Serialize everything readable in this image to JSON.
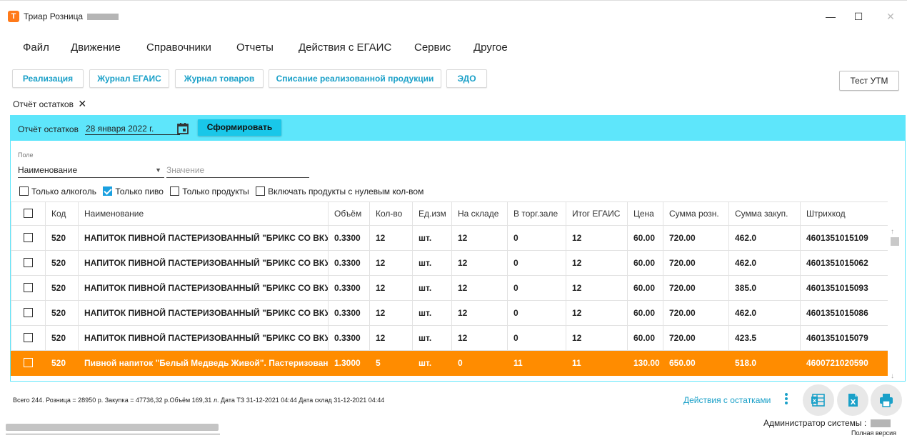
{
  "window": {
    "title": "Триар Розница",
    "logo_letter": "T",
    "minimize": "—",
    "maximize": "☐",
    "close": "✕"
  },
  "menu": [
    "Файл",
    "Движение",
    "Справочники",
    "Отчеты",
    "Действия с ЕГАИС",
    "Сервис",
    "Другое"
  ],
  "quick_buttons": [
    "Реализация",
    "Журнал ЕГАИС",
    "Журнал товаров",
    "Списание реализованной продукции",
    "ЭДО"
  ],
  "test_utm": "Тест УТМ",
  "doc_tab": {
    "label": "Отчёт остатков",
    "close": "✕"
  },
  "report_bar": {
    "label": "Отчёт остатков",
    "date": "28 января 2022 г.",
    "form_button": "Сформировать"
  },
  "filter": {
    "field_label": "Поле",
    "field_value": "Наименование",
    "value_placeholder": "Значение",
    "checkboxes": [
      {
        "label": "Только алкоголь",
        "checked": false
      },
      {
        "label": "Только пиво",
        "checked": true
      },
      {
        "label": "Только продукты",
        "checked": false
      },
      {
        "label": "Включать продукты с нулевым кол-вом",
        "checked": false
      }
    ]
  },
  "table": {
    "columns": [
      "",
      "Код",
      "Наименование",
      "Объём",
      "Кол-во",
      "Ед.изм",
      "На складе",
      "В торг.зале",
      "Итог ЕГАИС",
      "Цена",
      "Сумма розн.",
      "Сумма закуп.",
      "Штрихкод"
    ],
    "rows": [
      {
        "code": "520",
        "name": "НАПИТОК ПИВНОЙ ПАСТЕРИЗОВАННЫЙ \"БРИКС СО ВКУСОМ",
        "volume": "0.3300",
        "qty": "12",
        "unit": "шт.",
        "stock": "12",
        "hall": "0",
        "egais": "12",
        "price": "60.00",
        "retail": "720.00",
        "purchase": "462.0",
        "barcode": "4601351015109",
        "selected": false
      },
      {
        "code": "520",
        "name": "НАПИТОК ПИВНОЙ ПАСТЕРИЗОВАННЫЙ \"БРИКС СО ВКУСОМ",
        "volume": "0.3300",
        "qty": "12",
        "unit": "шт.",
        "stock": "12",
        "hall": "0",
        "egais": "12",
        "price": "60.00",
        "retail": "720.00",
        "purchase": "462.0",
        "barcode": "4601351015062",
        "selected": false
      },
      {
        "code": "520",
        "name": "НАПИТОК ПИВНОЙ ПАСТЕРИЗОВАННЫЙ \"БРИКС СО ВКУСОМ",
        "volume": "0.3300",
        "qty": "12",
        "unit": "шт.",
        "stock": "12",
        "hall": "0",
        "egais": "12",
        "price": "60.00",
        "retail": "720.00",
        "purchase": "385.0",
        "barcode": "4601351015093",
        "selected": false
      },
      {
        "code": "520",
        "name": "НАПИТОК ПИВНОЙ ПАСТЕРИЗОВАННЫЙ \"БРИКС СО ВКУСОМ",
        "volume": "0.3300",
        "qty": "12",
        "unit": "шт.",
        "stock": "12",
        "hall": "0",
        "egais": "12",
        "price": "60.00",
        "retail": "720.00",
        "purchase": "462.0",
        "barcode": "4601351015086",
        "selected": false
      },
      {
        "code": "520",
        "name": "НАПИТОК ПИВНОЙ ПАСТЕРИЗОВАННЫЙ \"БРИКС СО ВКУСОМ",
        "volume": "0.3300",
        "qty": "12",
        "unit": "шт.",
        "stock": "12",
        "hall": "0",
        "egais": "12",
        "price": "60.00",
        "retail": "720.00",
        "purchase": "423.5",
        "barcode": "4601351015079",
        "selected": false
      },
      {
        "code": "520",
        "name": "Пивной напиток \"Белый Медведь Живой\". Пастеризованный",
        "volume": "1.3000",
        "qty": "5",
        "unit": "шт.",
        "stock": "0",
        "hall": "11",
        "egais": "11",
        "price": "130.00",
        "retail": "650.00",
        "purchase": "518.0",
        "barcode": "4600721020590",
        "selected": true
      }
    ]
  },
  "footer": {
    "summary": "Всего 244. Розница = 28950 р. Закупка = 47736,32 р.Объём 169,31 л. Дата ТЗ 31-12-2021 04:44 Дата склад 31-12-2021 04:44",
    "actions_link": "Действия с остатками",
    "admin": "Администратор системы :",
    "version": "Полная версия"
  },
  "colors": {
    "accent": "#5ee6fb",
    "accent_button": "#19c7e9",
    "link": "#1aa0c8",
    "selected_row": "#ff8c00",
    "logo": "#ff7a1a"
  },
  "icons": [
    "calendar-icon",
    "excel-icon",
    "excel-x-icon",
    "printer-icon",
    "kebab-menu-icon",
    "scroll-up-icon",
    "scroll-down-icon"
  ]
}
